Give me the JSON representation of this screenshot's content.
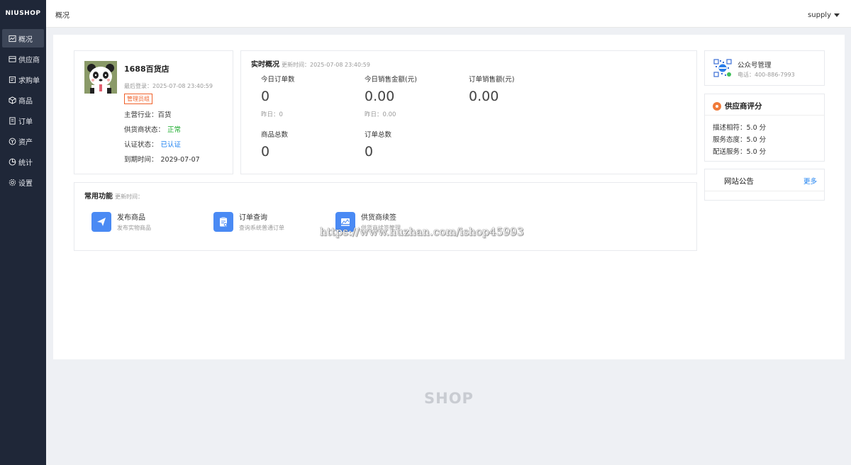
{
  "app": {
    "logo": "NIUSHOP"
  },
  "sidebar": {
    "items": [
      {
        "label": "概况",
        "icon": "dashboard-icon",
        "active": true
      },
      {
        "label": "供应商",
        "icon": "supplier-icon"
      },
      {
        "label": "求购单",
        "icon": "purchase-icon"
      },
      {
        "label": "商品",
        "icon": "goods-icon"
      },
      {
        "label": "订单",
        "icon": "order-icon"
      },
      {
        "label": "资产",
        "icon": "asset-icon"
      },
      {
        "label": "统计",
        "icon": "stats-icon"
      },
      {
        "label": "设置",
        "icon": "settings-icon"
      }
    ]
  },
  "header": {
    "title": "概况",
    "user": "supply"
  },
  "store": {
    "name": "1688百货店",
    "last_login": "最后登录：2025-07-08 23:40:59",
    "role_badge": "管理员组",
    "industry_label": "主营行业：",
    "industry_value": "百货",
    "supplier_status_label": "供货商状态：",
    "supplier_status_value": "正常",
    "auth_status_label": "认证状态：",
    "auth_status_value": "已认证",
    "expire_label": "到期时间：",
    "expire_value": "2029-07-07"
  },
  "realtime": {
    "title": "实时概况",
    "update_time": "更新时间：2025-07-08 23:40:59",
    "stats": [
      {
        "label": "今日订单数",
        "value": "0",
        "sub": "昨日：0"
      },
      {
        "label": "今日销售金额(元)",
        "value": "0.00",
        "sub": "昨日：0.00"
      },
      {
        "label": "订单销售额(元)",
        "value": "0.00",
        "sub": ""
      },
      {
        "label": "商品总数",
        "value": "0",
        "sub": ""
      },
      {
        "label": "订单总数",
        "value": "0",
        "sub": ""
      }
    ]
  },
  "functions": {
    "title": "常用功能",
    "update_time": "更新时间：",
    "items": [
      {
        "title": "发布商品",
        "desc": "发布实物商品",
        "icon": "paper-plane-icon"
      },
      {
        "title": "订单查询",
        "desc": "查询系统普通订单",
        "icon": "clipboard-icon"
      },
      {
        "title": "供货商续签",
        "desc": "供货商续签管理",
        "icon": "renew-icon"
      }
    ]
  },
  "wechat": {
    "title": "公众号管理",
    "phone": "电话：400-886-7993",
    "icon": "qr-code-icon"
  },
  "rating": {
    "title": "供应商评分",
    "rows": [
      {
        "label": "描述相符：",
        "value": "5.0 分"
      },
      {
        "label": "服务态度：",
        "value": "5.0 分"
      },
      {
        "label": "配送服务：",
        "value": "5.0 分"
      }
    ]
  },
  "notice": {
    "title": "网站公告",
    "more": "更多"
  },
  "watermark": "https://www.huzhan.com/ishop45993",
  "footer": {
    "brand": "SHOP"
  },
  "colors": {
    "sidebar": "#1f2738",
    "accent_blue": "#1a7ff0",
    "success_green": "#1aab2b",
    "badge_orange": "#f0612a",
    "icon_blue": "#4a8af4"
  }
}
